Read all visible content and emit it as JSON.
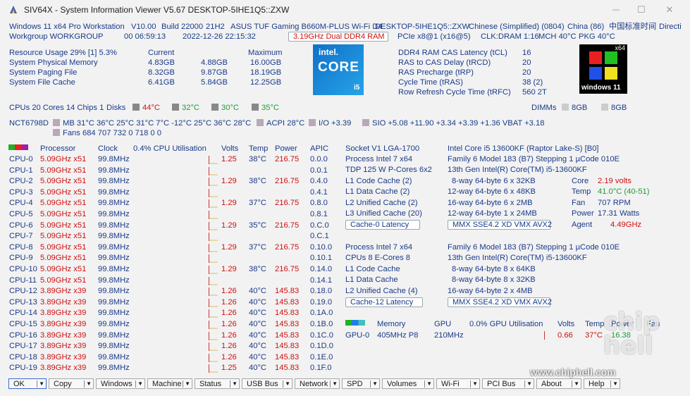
{
  "window": {
    "title": "SIV64X - System Information Viewer V5.67 DESKTOP-5IHE1Q5::ZXW",
    "min": "─",
    "max": "☐",
    "close": "✕"
  },
  "header": {
    "line1": [
      "Windows 11 x64 Pro Workstation",
      "V10.00",
      "Build 22000",
      "21H2",
      "ASUS TUF Gaming B660M-PLUS Wi-Fi D4",
      "DESKTOP-5IHE1Q5::ZXW",
      "Chinese (Simplified) (0804)",
      "China (86)",
      "中国标准时间",
      "Directi"
    ],
    "line2": [
      "Workgroup WORKGROUP",
      "00 06:59:13",
      "2022-12-26 22:15:32",
      "3.19GHz Dual DDR4 RAM",
      "PCIe x8@1 (x16@5)",
      "CLK:DRAM 1:16",
      "MCH 40°C",
      "PKG 40°C"
    ]
  },
  "resources": {
    "title": "Resource Usage 29% [1] 5.3%",
    "current_label": "Current",
    "max_label": "Maximum",
    "rows": [
      {
        "label": "System Physical Memory",
        "current": "4.83GB",
        "mid": "4.88GB",
        "max": "16.00GB"
      },
      {
        "label": "System Paging File",
        "current": "8.32GB",
        "mid": "9.87GB",
        "max": "18.19GB"
      },
      {
        "label": "System File Cache",
        "current": "6.41GB",
        "mid": "5.84GB",
        "max": "12.25GB"
      }
    ]
  },
  "intel_logo": {
    "brand": "intel.",
    "core": "CORE",
    "tier": "i5"
  },
  "ram_timings": [
    {
      "label": "DDR4 RAM CAS Latency (tCL)",
      "value": "16"
    },
    {
      "label": "RAS to CAS Delay (tRCD)",
      "value": "20"
    },
    {
      "label": "RAS Precharge (tRP)",
      "value": "20"
    },
    {
      "label": "Cycle Time (tRAS)",
      "value": "38 (2)"
    },
    {
      "label": "Row Refresh Cycle Time (tRFC)",
      "value": "560 2T"
    }
  ],
  "win_logo": {
    "x64": "x64",
    "label": "windows 11"
  },
  "cpu_line": {
    "text": "CPUs 20 Cores 14 Chips 1",
    "disks": "Disks",
    "temps": [
      "44°C",
      "32°C",
      "30°C",
      "35°C"
    ],
    "dimms": "DIMMs",
    "dimm_sizes": [
      "8GB",
      "8GB"
    ]
  },
  "sensors": {
    "chip": "NCT6798D",
    "mb": "MB 31°C 36°C 25°C 31°C 7°C -12°C 25°C 36°C 28°C",
    "acpi": "ACPI 28°C",
    "io": "I/O +3.39",
    "sio": "SIO +5.08 +11.90 +3.34 +3.39 +1.36 VBAT +3.18",
    "fans": "Fans 684 707 732 0 718 0 0"
  },
  "cpu_table": {
    "headers": {
      "processor": "Processor",
      "clock": "Clock",
      "util": "0.4% CPU Utilisation",
      "volts": "Volts",
      "temp": "Temp",
      "power": "Power",
      "apic": "APIC"
    },
    "rows": [
      {
        "name": "CPU-0",
        "freq": "5.09GHz x51",
        "clock": "99.8MHz",
        "volts": "1.25",
        "temp": "38°C",
        "power": "216.75",
        "apic": "0.0.0"
      },
      {
        "name": "CPU-1",
        "freq": "5.09GHz x51",
        "clock": "99.8MHz",
        "volts": "",
        "temp": "",
        "power": "",
        "apic": "0.0.1"
      },
      {
        "name": "CPU-2",
        "freq": "5.09GHz x51",
        "clock": "99.8MHz",
        "volts": "1.29",
        "temp": "38°C",
        "power": "216.75",
        "apic": "0.4.0"
      },
      {
        "name": "CPU-3",
        "freq": "5.09GHz x51",
        "clock": "99.8MHz",
        "volts": "",
        "temp": "",
        "power": "",
        "apic": "0.4.1"
      },
      {
        "name": "CPU-4",
        "freq": "5.09GHz x51",
        "clock": "99.8MHz",
        "volts": "1.29",
        "temp": "37°C",
        "power": "216.75",
        "apic": "0.8.0"
      },
      {
        "name": "CPU-5",
        "freq": "5.09GHz x51",
        "clock": "99.8MHz",
        "volts": "",
        "temp": "",
        "power": "",
        "apic": "0.8.1"
      },
      {
        "name": "CPU-6",
        "freq": "5.09GHz x51",
        "clock": "99.8MHz",
        "volts": "1.29",
        "temp": "35°C",
        "power": "216.75",
        "apic": "0.C.0"
      },
      {
        "name": "CPU-7",
        "freq": "5.09GHz x51",
        "clock": "99.8MHz",
        "volts": "",
        "temp": "",
        "power": "",
        "apic": "0.C.1"
      },
      {
        "name": "CPU-8",
        "freq": "5.09GHz x51",
        "clock": "99.8MHz",
        "volts": "1.29",
        "temp": "37°C",
        "power": "216.75",
        "apic": "0.10.0"
      },
      {
        "name": "CPU-9",
        "freq": "5.09GHz x51",
        "clock": "99.8MHz",
        "volts": "",
        "temp": "",
        "power": "",
        "apic": "0.10.1"
      },
      {
        "name": "CPU-10",
        "freq": "5.09GHz x51",
        "clock": "99.8MHz",
        "volts": "1.29",
        "temp": "38°C",
        "power": "216.75",
        "apic": "0.14.0"
      },
      {
        "name": "CPU-11",
        "freq": "5.09GHz x51",
        "clock": "99.8MHz",
        "volts": "",
        "temp": "",
        "power": "",
        "apic": "0.14.1"
      },
      {
        "name": "CPU-12",
        "freq": "3.89GHz x39",
        "clock": "99.8MHz",
        "volts": "1.26",
        "temp": "40°C",
        "power": "145.83",
        "apic": "0.18.0"
      },
      {
        "name": "CPU-13",
        "freq": "3.89GHz x39",
        "clock": "99.8MHz",
        "volts": "1.26",
        "temp": "40°C",
        "power": "145.83",
        "apic": "0.19.0"
      },
      {
        "name": "CPU-14",
        "freq": "3.89GHz x39",
        "clock": "99.8MHz",
        "volts": "1.26",
        "temp": "40°C",
        "power": "145.83",
        "apic": "0.1A.0"
      },
      {
        "name": "CPU-15",
        "freq": "3.89GHz x39",
        "clock": "99.8MHz",
        "volts": "1.26",
        "temp": "40°C",
        "power": "145.83",
        "apic": "0.1B.0"
      },
      {
        "name": "CPU-16",
        "freq": "3.89GHz x39",
        "clock": "99.8MHz",
        "volts": "1.26",
        "temp": "40°C",
        "power": "145.83",
        "apic": "0.1C.0"
      },
      {
        "name": "CPU-17",
        "freq": "3.89GHz x39",
        "clock": "99.8MHz",
        "volts": "1.26",
        "temp": "40°C",
        "power": "145.83",
        "apic": "0.1D.0"
      },
      {
        "name": "CPU-18",
        "freq": "3.89GHz x39",
        "clock": "99.8MHz",
        "volts": "1.26",
        "temp": "40°C",
        "power": "145.83",
        "apic": "0.1E.0"
      },
      {
        "name": "CPU-19",
        "freq": "3.89GHz x39",
        "clock": "99.8MHz",
        "volts": "1.25",
        "temp": "40°C",
        "power": "145.83",
        "apic": "0.1F.0"
      }
    ]
  },
  "pcore": {
    "left": [
      "Socket V1 LGA-1700",
      "Process Intel 7  x64",
      "TDP 125 W P-Cores 6x2",
      "L1 Code Cache (2)",
      "L1 Data Cache (2)",
      "L2 Unified Cache (2)",
      "L3 Unified Cache (20)"
    ],
    "right": [
      "Intel Core i5 13600KF (Raptor Lake-S) [B0]",
      "Family 6  Model 183 (B7)  Stepping 1  µCode 010E",
      "13th Gen Intel(R) Core(TM) i5-13600KF",
      "8-way 64-byte  6 x 32KB",
      "12-way 64-byte  6 x 48KB",
      "16-way 64-byte  6 x 2MB",
      "12-way 64-byte  1 x 24MB"
    ],
    "latency_btn": "Cache-0 Latency",
    "features": "MMX SSE4.2 XD VMX AVX2",
    "stats": [
      {
        "label": "Core",
        "value": "2.19 volts"
      },
      {
        "label": "Temp",
        "value": "41.0°C (40-51)"
      },
      {
        "label": "Fan",
        "value": "707 RPM"
      },
      {
        "label": "Power",
        "value": "17.31 Watts"
      },
      {
        "label": "Agent",
        "value": "4.49GHz"
      }
    ]
  },
  "ecore": {
    "left": [
      "Process Intel 7  x64",
      "CPUs 8 E-Cores 8",
      "L1 Code Cache",
      "L1 Data Cache",
      "L2 Unified Cache (4)"
    ],
    "right": [
      "Family 6  Model 183 (B7)  Stepping 1  µCode 010E",
      "13th Gen Intel(R) Core(TM) i5-13600KF",
      "8-way 64-byte  8 x 64KB",
      "8-way 64-byte  8 x 32KB",
      "16-way 64-byte  2 x 4MB"
    ],
    "latency_btn": "Cache-12 Latency",
    "features": "MMX SSE4.2 XD VMX AVX2"
  },
  "gpu": {
    "headers": {
      "memory": "Memory",
      "gpu": "GPU",
      "util": "0.0% GPU Utilisation",
      "volts": "Volts",
      "temp": "Temp",
      "power": "Power",
      "fan": "Fan"
    },
    "row": {
      "name": "GPU-0",
      "memory": "405MHz P8",
      "gpu": "210MHz",
      "volts": "0.66",
      "temp": "37°C",
      "power": "16.38"
    }
  },
  "buttons": [
    "OK",
    "Copy",
    "Windows",
    "Machine",
    "Status",
    "USB Bus",
    "Network",
    "SPD",
    "Volumes",
    "Wi-Fi",
    "PCI Bus",
    "About",
    "Help"
  ],
  "watermark": {
    "brand": "chip hell",
    "url": "www.chiphell.com"
  }
}
